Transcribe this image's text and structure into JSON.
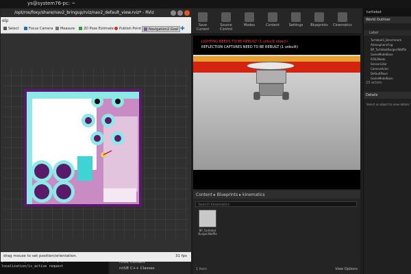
{
  "system": {
    "title": "ys@system76-pc: ~"
  },
  "rviz": {
    "title": "/opt/ros/foxy/share/nav2_bringup/rviz/nav2_default_view.rviz* - RViz",
    "menu": "elp",
    "tools": [
      {
        "label": "Select",
        "icon": "cursor-icon"
      },
      {
        "label": "Focus Camera",
        "icon": "camera-icon"
      },
      {
        "label": "Measure",
        "icon": "ruler-icon"
      },
      {
        "label": "2D Pose Estimate",
        "icon": "arrow-icon"
      },
      {
        "label": "Publish Point",
        "icon": "pin-icon"
      },
      {
        "label": "Navigation2 Goal",
        "icon": "goal-icon"
      }
    ],
    "status_hint": "drag mouse to set position/orientation.",
    "fps": "31 fps"
  },
  "unreal": {
    "toolbar": [
      "Save Current",
      "Source Control",
      "Modes",
      "Content",
      "Settings",
      "Blueprints",
      "Cinematics"
    ],
    "viewport_warning_1": "LIGHTING NEEDS TO BE REBUILT (1 unbuilt object)",
    "viewport_warning_2": "REFLECTION CAPTURES NEED TO BE REBUILT (1 unbuilt)",
    "content_browser": {
      "breadcrumb": "Content  ▸  Blueprints  ▸  kinematics",
      "search_placeholder": "Search kinematics",
      "asset_label": "BP_Turtlebot Burger/Waffle",
      "item_count": "1 item",
      "view_options": "View Options"
    },
    "world_outliner": {
      "title": "World Outliner",
      "column": "Label",
      "rows": [
        "Turtlebot3_Benchmark",
        "AtmosphericFog",
        "BP_TurtlebotBurger/Waffle",
        "GameModeBase",
        "ROS2Node",
        "SensorLidar",
        "CameraActor",
        "DefaultPawn",
        "GameModeBase"
      ],
      "count": "23 actors"
    },
    "details": {
      "title": "Details",
      "hint": "Select an object to view details"
    },
    "titlebar": "turtlebot"
  },
  "terminal": {
    "lines": [
      "[controller_server-8] [INFO] [controller",
      "localization/is_active request"
    ]
  },
  "taskpanel": {
    "items": [
      "rclUE Content",
      "rclUE C++ Classes"
    ]
  }
}
